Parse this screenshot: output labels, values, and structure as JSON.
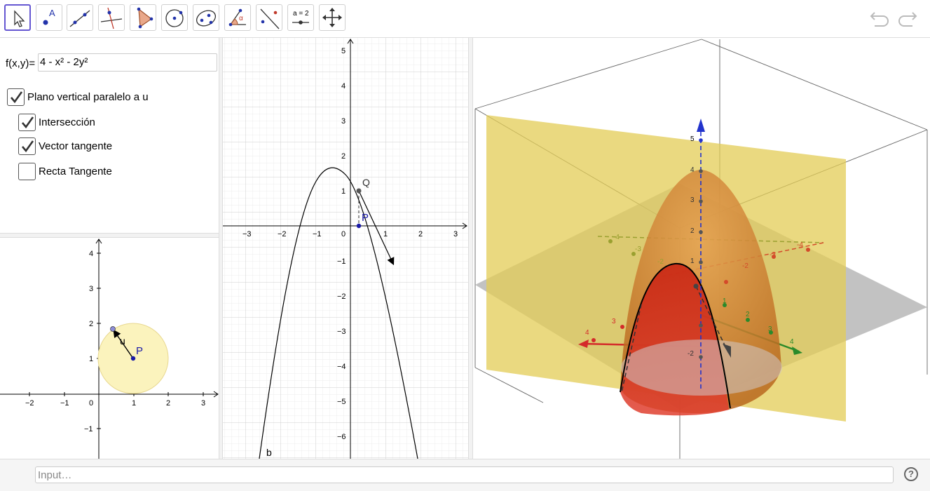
{
  "toolbar": {
    "tools": [
      {
        "name": "move-tool",
        "label": ""
      },
      {
        "name": "point-tool",
        "label": "A"
      },
      {
        "name": "line-tool",
        "label": ""
      },
      {
        "name": "perpendicular-tool",
        "label": ""
      },
      {
        "name": "polygon-tool",
        "label": ""
      },
      {
        "name": "circle-tool",
        "label": ""
      },
      {
        "name": "ellipse-tool",
        "label": ""
      },
      {
        "name": "angle-tool",
        "label": "α"
      },
      {
        "name": "reflect-tool",
        "label": ""
      },
      {
        "name": "slider-tool",
        "label": "a = 2"
      },
      {
        "name": "move-view-tool",
        "label": ""
      }
    ],
    "undo_icon": "undo-icon",
    "redo_icon": "redo-icon"
  },
  "algebra": {
    "function_label": "f(x,y)=",
    "function_value": "4 - x² - 2y²",
    "checkboxes": [
      {
        "label": "Plano vertical paralelo a u",
        "checked": true
      },
      {
        "label": "Intersección",
        "checked": true
      },
      {
        "label": "Vector tangente",
        "checked": true
      },
      {
        "label": "Recta Tangente",
        "checked": false
      }
    ]
  },
  "view2d_small": {
    "x_ticks": [
      "−2",
      "−1",
      "0",
      "1",
      "2",
      "3"
    ],
    "y_ticks": [
      "4",
      "3",
      "2",
      "1",
      "−1"
    ],
    "vector_label": "u",
    "point_label": "P"
  },
  "view2d_main": {
    "x_ticks": [
      "−3",
      "−2",
      "−1",
      "0",
      "1",
      "2",
      "3"
    ],
    "y_ticks": [
      "5",
      "4",
      "3",
      "2",
      "1",
      "−1",
      "−2",
      "−3",
      "−4",
      "−5",
      "−6"
    ],
    "point_q": "Q",
    "point_p": "P",
    "curve_label": "b"
  },
  "view3d": {
    "z_ticks": [
      "5",
      "4",
      "3",
      "2",
      "1",
      "-2"
    ],
    "x_ticks": [
      "4",
      "3"
    ],
    "neg_x_ticks": [
      "-4",
      "-3",
      "-2"
    ],
    "y_ticks": [
      "4",
      "3",
      "2",
      "1"
    ],
    "neg_y_ticks": [
      "-4",
      "-3",
      "-2"
    ],
    "colors": {
      "x_axis": "#d42a2a",
      "y_axis": "#2a8a2a",
      "z_axis": "#2233cc",
      "plane": "#e8d25a",
      "surface": "#d07a2a"
    }
  },
  "input": {
    "placeholder": "Input…",
    "help_label": "?"
  }
}
